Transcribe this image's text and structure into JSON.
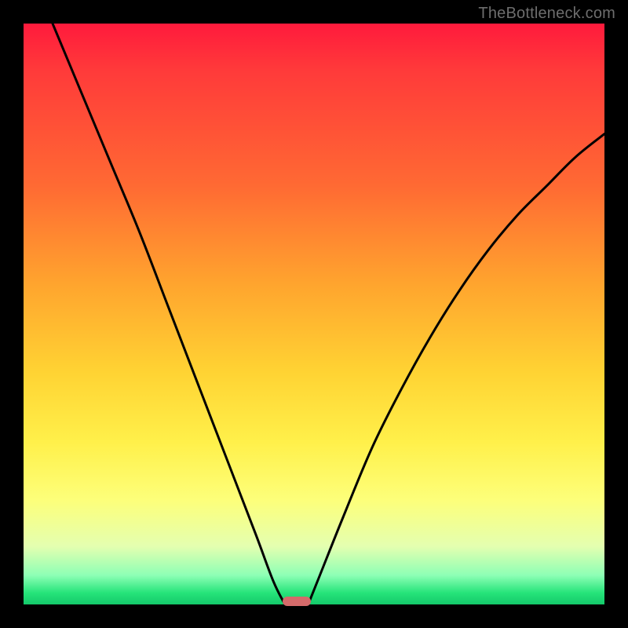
{
  "watermark": "TheBottleneck.com",
  "chart_data": {
    "type": "line",
    "title": "",
    "xlabel": "",
    "ylabel": "",
    "xlim": [
      0,
      100
    ],
    "ylim": [
      0,
      100
    ],
    "grid": false,
    "legend": false,
    "background_gradient": {
      "direction": "vertical",
      "stops": [
        {
          "pos": 0,
          "color": "#ff1a3c"
        },
        {
          "pos": 45,
          "color": "#ffa52e"
        },
        {
          "pos": 72,
          "color": "#fff04a"
        },
        {
          "pos": 95,
          "color": "#8dffb5"
        },
        {
          "pos": 100,
          "color": "#14c96a"
        }
      ]
    },
    "series": [
      {
        "name": "left-branch",
        "x": [
          5,
          10,
          15,
          20,
          25,
          30,
          35,
          40,
          43,
          45
        ],
        "y": [
          100,
          88,
          76,
          64,
          51,
          38,
          25,
          12,
          4,
          0
        ]
      },
      {
        "name": "right-branch",
        "x": [
          49,
          51,
          55,
          60,
          65,
          70,
          75,
          80,
          85,
          90,
          95,
          100
        ],
        "y": [
          0,
          5,
          15,
          27,
          37,
          46,
          54,
          61,
          67,
          72,
          77,
          81
        ]
      }
    ],
    "markers": [
      {
        "name": "bottleneck-marker",
        "x": 47,
        "y": 0.6,
        "shape": "rounded-bar",
        "color": "#d46a6a"
      }
    ]
  }
}
